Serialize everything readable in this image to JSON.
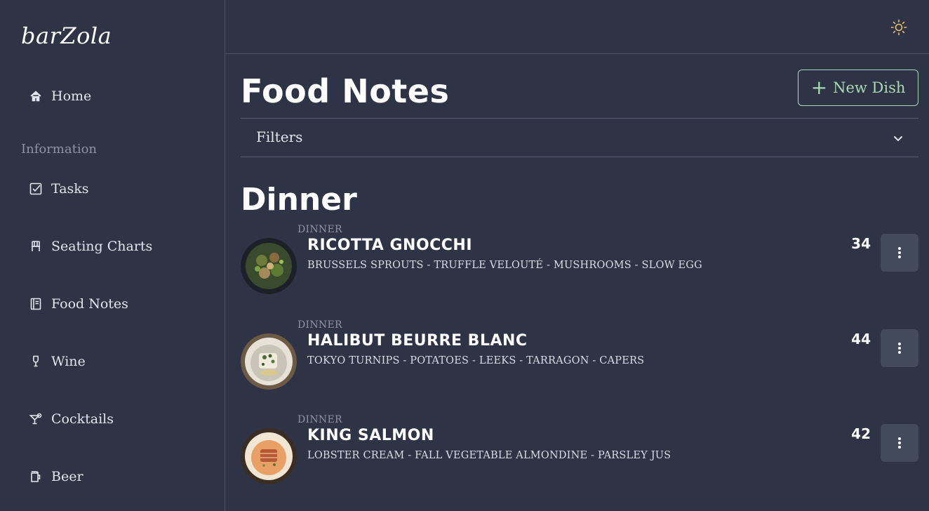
{
  "app": {
    "logo": "barZola"
  },
  "sidebar": {
    "home": "Home",
    "section_label": "Information",
    "items": [
      {
        "label": "Tasks",
        "icon": "checkbox-icon"
      },
      {
        "label": "Seating Charts",
        "icon": "chair-icon"
      },
      {
        "label": "Food Notes",
        "icon": "notebook-icon"
      },
      {
        "label": "Wine",
        "icon": "wine-glass-icon"
      },
      {
        "label": "Cocktails",
        "icon": "cocktail-icon"
      },
      {
        "label": "Beer",
        "icon": "beer-mug-icon"
      }
    ]
  },
  "header": {
    "theme_icon": "sun-icon"
  },
  "main": {
    "title": "Food Notes",
    "new_button": "New Dish",
    "filters_label": "Filters",
    "section_title": "Dinner",
    "dishes": [
      {
        "category": "DINNER",
        "name": "RICOTTA GNOCCHI",
        "description": "BRUSSELS SPROUTS - TRUFFLE VELOUTÉ - MUSHROOMS - SLOW EGG",
        "count": "34"
      },
      {
        "category": "DINNER",
        "name": "HALIBUT BEURRE BLANC",
        "description": "TOKYO TURNIPS - POTATOES - LEEKS - TARRAGON - CAPERS",
        "count": "44"
      },
      {
        "category": "DINNER",
        "name": "KING SALMON",
        "description": "LOBSTER CREAM - FALL VEGETABLE ALMONDINE - PARSLEY JUS",
        "count": "42"
      }
    ]
  },
  "colors": {
    "background": "#2e3445",
    "accent": "#a9d8b2",
    "menu_button": "#434a5b",
    "muted": "#8b93a5"
  }
}
